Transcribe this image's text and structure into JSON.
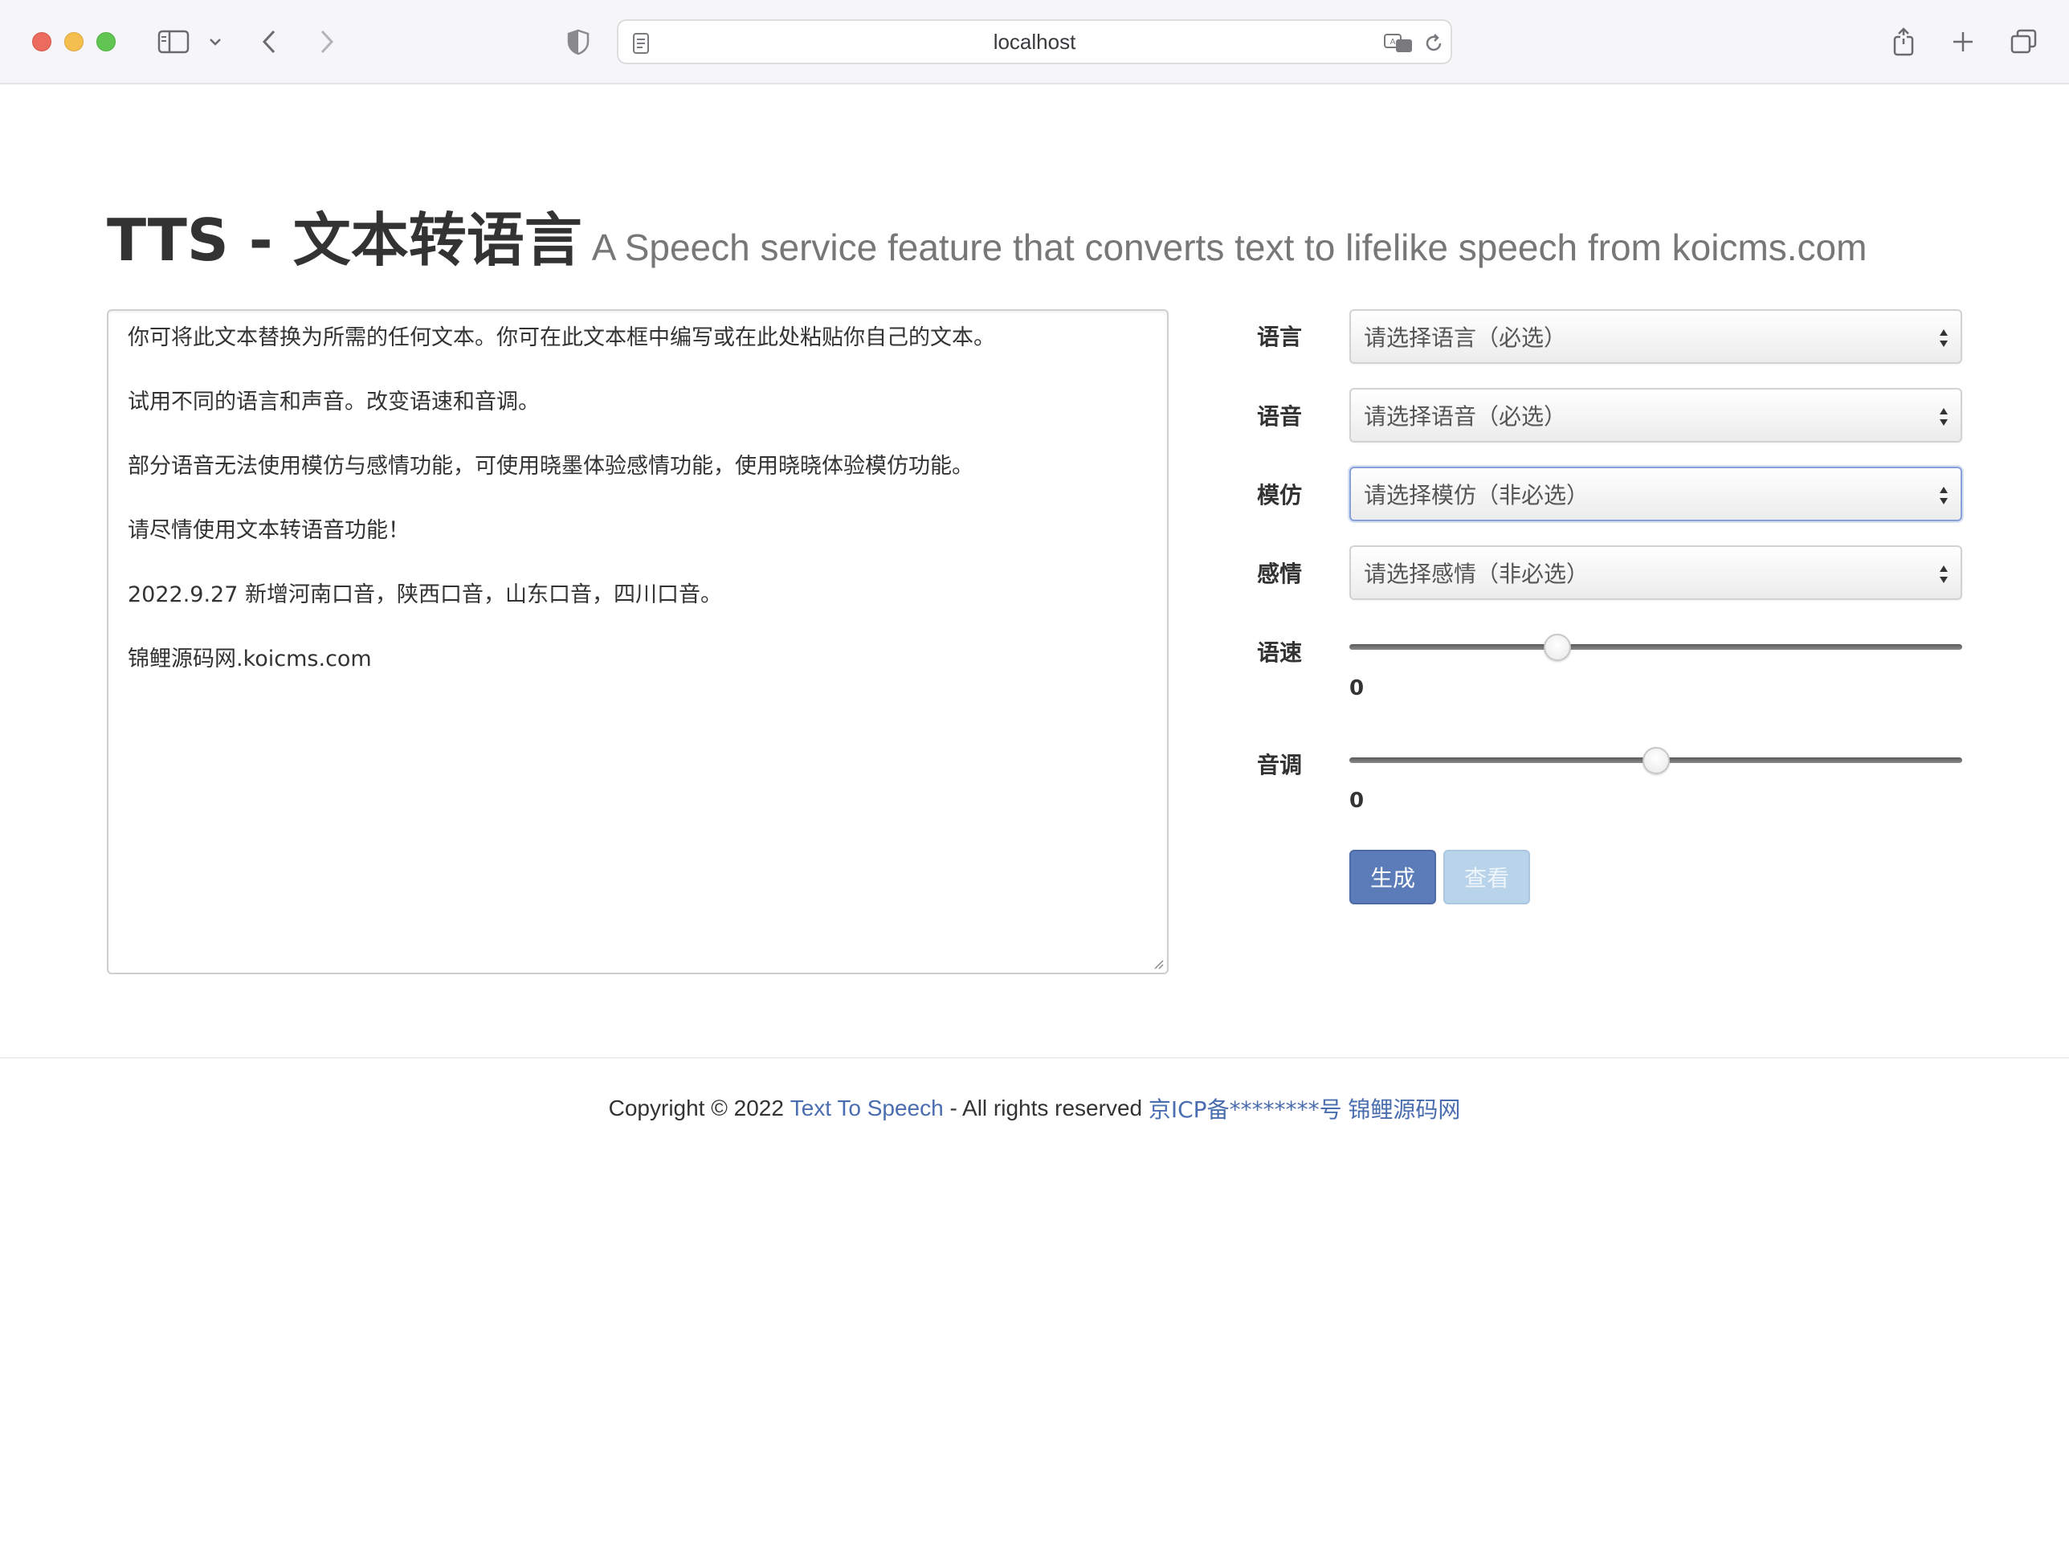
{
  "browser": {
    "url": "localhost"
  },
  "header": {
    "title": "TTS - 文本转语言",
    "subtitle": "A Speech service feature that converts text to lifelike speech from koicms.com"
  },
  "editor": {
    "lines": [
      "你可将此文本替换为所需的任何文本。你可在此文本框中编写或在此处粘贴你自己的文本。",
      "试用不同的语言和声音。改变语速和音调。",
      "部分语音无法使用模仿与感情功能，可使用晓墨体验感情功能，使用晓晓体验模仿功能。",
      "请尽情使用文本转语音功能！",
      "2022.9.27 新增河南口音，陕西口音，山东口音，四川口音。",
      "锦鲤源码网.koicms.com"
    ]
  },
  "form": {
    "language": {
      "label": "语言",
      "value": "请选择语言（必选）"
    },
    "voice": {
      "label": "语音",
      "value": "请选择语音（必选）"
    },
    "imitate": {
      "label": "模仿",
      "value": "请选择模仿（非必选）"
    },
    "emotion": {
      "label": "感情",
      "value": "请选择感情（非必选）"
    },
    "rate": {
      "label": "语速",
      "value": "0",
      "fraction": 0.34
    },
    "pitch": {
      "label": "音调",
      "value": "0",
      "fraction": 0.5
    },
    "generate_label": "生成",
    "view_label": "查看"
  },
  "footer": {
    "copyright": "Copyright © 2022",
    "site_link": "Text To Speech",
    "rights": "- All rights reserved",
    "icp_link": "京ICP备********号",
    "brand_link": "锦鲤源码网"
  }
}
